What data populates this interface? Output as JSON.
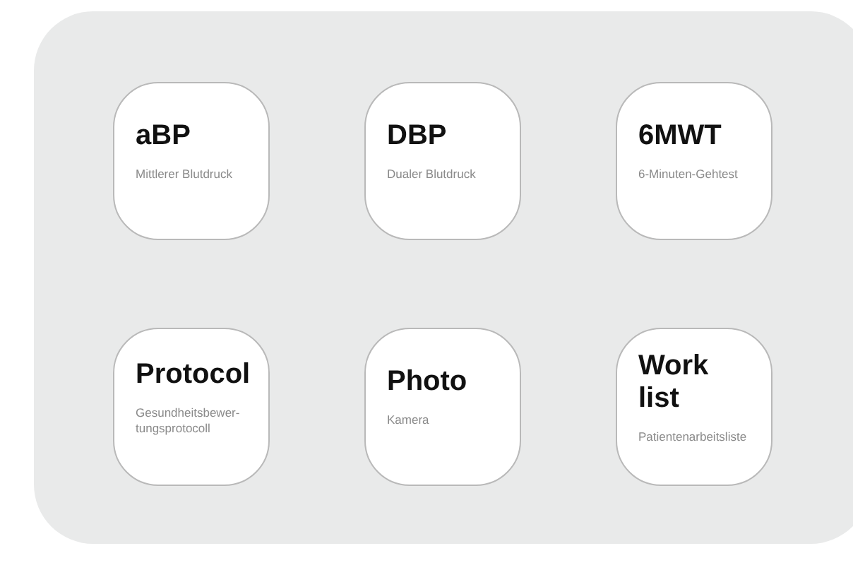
{
  "tiles": [
    {
      "title": "aBP",
      "subtitle": "Mittlerer Blutdruck"
    },
    {
      "title": "DBP",
      "subtitle": "Dualer Blutdruck"
    },
    {
      "title": "6MWT",
      "subtitle": "6-Minuten-Gehtest"
    },
    {
      "title": "Protocol",
      "subtitle": "Gesundheitsbewer-tungsprotocoll"
    },
    {
      "title": "Photo",
      "subtitle": "Kamera"
    },
    {
      "title": "Work\nlist",
      "subtitle": "Patientenarbeitsliste"
    }
  ]
}
